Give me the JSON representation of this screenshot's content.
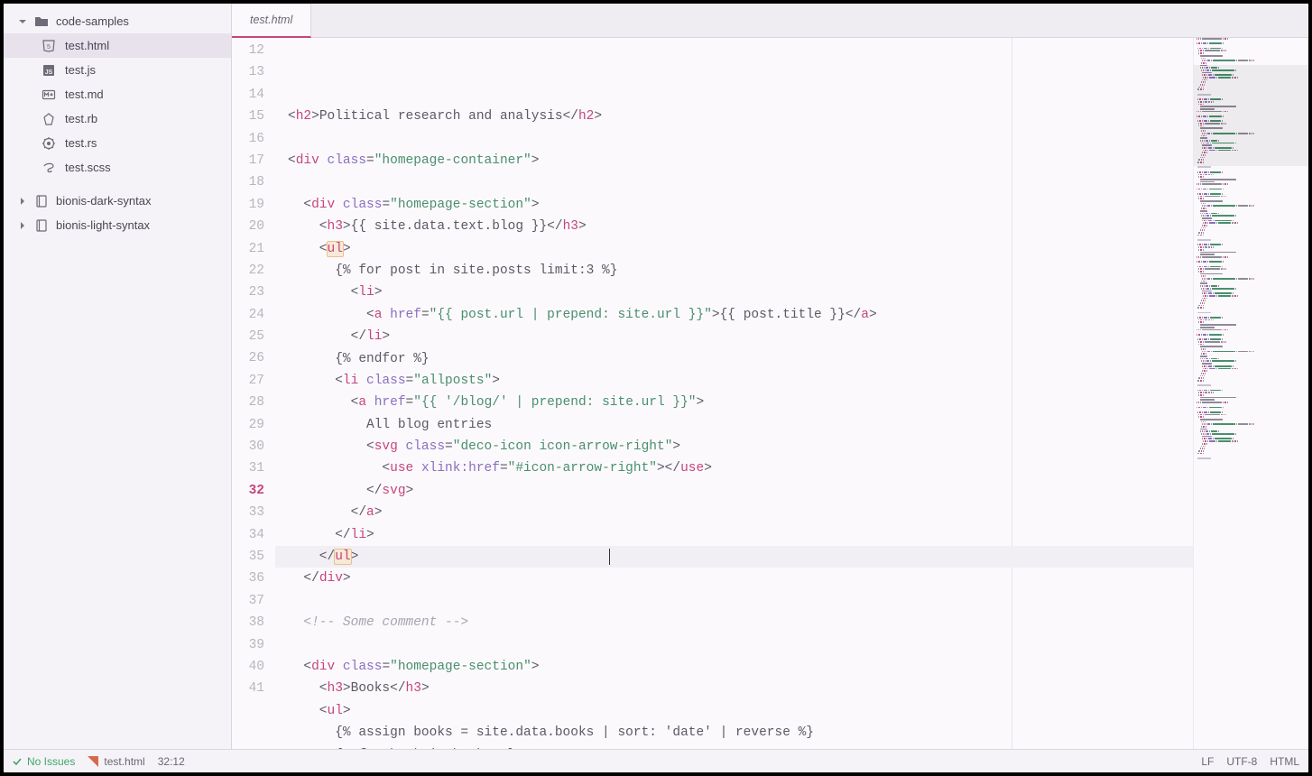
{
  "sidebar": {
    "root": {
      "name": "code-samples",
      "expanded": true
    },
    "files": [
      {
        "name": "test.html",
        "kind": "html",
        "active": true
      },
      {
        "name": "test.js",
        "kind": "js"
      },
      {
        "name": "test.md",
        "kind": "md"
      },
      {
        "name": "test.rb",
        "kind": "rb"
      },
      {
        "name": "test.rs",
        "kind": "rs"
      },
      {
        "name": "test.scss",
        "kind": "scss"
      }
    ],
    "folders": [
      {
        "name": "bionis-dark-syntax",
        "expanded": false
      },
      {
        "name": "bionis-light-syntax",
        "expanded": false
      }
    ]
  },
  "tab": {
    "title": "test.html"
  },
  "editor": {
    "first_line": 12,
    "cursor_line": 32,
    "lines": [
      [
        [
          "pn",
          "<"
        ],
        [
          "tg",
          "h2"
        ],
        [
          "pn",
          ">"
        ],
        [
          "tx",
          "Political research and analysis"
        ],
        [
          "pn",
          "</"
        ],
        [
          "tg",
          "h2"
        ],
        [
          "pn",
          ">"
        ]
      ],
      [],
      [
        [
          "pn",
          "<"
        ],
        [
          "tg",
          "div"
        ],
        [
          "pn",
          " "
        ],
        [
          "at",
          "class"
        ],
        [
          "pn",
          "="
        ],
        [
          "st",
          "\"homepage-container\""
        ],
        [
          "pn",
          ">"
        ]
      ],
      [],
      [
        [
          "pn",
          "  <"
        ],
        [
          "tg",
          "div"
        ],
        [
          "pn",
          " "
        ],
        [
          "at",
          "class"
        ],
        [
          "pn",
          "="
        ],
        [
          "st",
          "\"homepage-section\""
        ],
        [
          "pn",
          ">"
        ]
      ],
      [
        [
          "pn",
          "    <"
        ],
        [
          "tg",
          "h3"
        ],
        [
          "pn",
          ">"
        ],
        [
          "lq",
          "{{ site.data.text.blog }}"
        ],
        [
          "pn",
          "</"
        ],
        [
          "tg",
          "h3"
        ],
        [
          "pn",
          ">"
        ]
      ],
      [
        [
          "pn",
          "    <"
        ],
        [
          "hl",
          "ul"
        ],
        [
          "pn",
          ">"
        ]
      ],
      [
        [
          "lq",
          "      {% for post in site.posts limit:3 %}"
        ]
      ],
      [
        [
          "pn",
          "        <"
        ],
        [
          "tg",
          "li"
        ],
        [
          "pn",
          ">"
        ]
      ],
      [
        [
          "pn",
          "          <"
        ],
        [
          "tg",
          "a"
        ],
        [
          "pn",
          " "
        ],
        [
          "at",
          "href"
        ],
        [
          "pn",
          "="
        ],
        [
          "st",
          "\"{{ post.url | prepend: site.url }}\""
        ],
        [
          "pn",
          ">"
        ],
        [
          "lq",
          "{{ post.title }}"
        ],
        [
          "pn",
          "</"
        ],
        [
          "tg",
          "a"
        ],
        [
          "pn",
          ">"
        ]
      ],
      [
        [
          "pn",
          "        </"
        ],
        [
          "tg",
          "li"
        ],
        [
          "pn",
          ">"
        ]
      ],
      [
        [
          "lq",
          "      {% endfor %}"
        ]
      ],
      [
        [
          "pn",
          "      <"
        ],
        [
          "tg",
          "li"
        ],
        [
          "pn",
          " "
        ],
        [
          "at",
          "class"
        ],
        [
          "pn",
          "="
        ],
        [
          "st",
          "\"allposts\""
        ],
        [
          "pn",
          ">"
        ]
      ],
      [
        [
          "pn",
          "        <"
        ],
        [
          "tg",
          "a"
        ],
        [
          "pn",
          " "
        ],
        [
          "at",
          "href"
        ],
        [
          "pn",
          "="
        ],
        [
          "st",
          "\"{{ '/blog/' | prepend: site.url }}\""
        ],
        [
          "pn",
          ">"
        ]
      ],
      [
        [
          "tx",
          "          All blog entries"
        ]
      ],
      [
        [
          "pn",
          "          <"
        ],
        [
          "tg",
          "svg"
        ],
        [
          "pn",
          " "
        ],
        [
          "at",
          "class"
        ],
        [
          "pn",
          "="
        ],
        [
          "st",
          "\"deco-icon icon-arrow-right\""
        ],
        [
          "pn",
          ">"
        ]
      ],
      [
        [
          "pn",
          "            <"
        ],
        [
          "tg",
          "use"
        ],
        [
          "pn",
          " "
        ],
        [
          "at",
          "xlink:href"
        ],
        [
          "pn",
          "="
        ],
        [
          "st",
          "\"#icon-arrow-right\""
        ],
        [
          "pn",
          "></"
        ],
        [
          "tg",
          "use"
        ],
        [
          "pn",
          ">"
        ]
      ],
      [
        [
          "pn",
          "          </"
        ],
        [
          "tg",
          "svg"
        ],
        [
          "pn",
          ">"
        ]
      ],
      [
        [
          "pn",
          "        </"
        ],
        [
          "tg",
          "a"
        ],
        [
          "pn",
          ">"
        ]
      ],
      [
        [
          "pn",
          "      </"
        ],
        [
          "tg",
          "li"
        ],
        [
          "pn",
          ">"
        ]
      ],
      [
        [
          "pn",
          "    </"
        ],
        [
          "hl",
          "ul"
        ],
        [
          "pn",
          ">"
        ]
      ],
      [
        [
          "pn",
          "  </"
        ],
        [
          "tg",
          "div"
        ],
        [
          "pn",
          ">"
        ]
      ],
      [],
      [
        [
          "cm",
          "  <!-- Some comment -->"
        ]
      ],
      [],
      [
        [
          "pn",
          "  <"
        ],
        [
          "tg",
          "div"
        ],
        [
          "pn",
          " "
        ],
        [
          "at",
          "class"
        ],
        [
          "pn",
          "="
        ],
        [
          "st",
          "\"homepage-section\""
        ],
        [
          "pn",
          ">"
        ]
      ],
      [
        [
          "pn",
          "    <"
        ],
        [
          "tg",
          "h3"
        ],
        [
          "pn",
          ">"
        ],
        [
          "tx",
          "Books"
        ],
        [
          "pn",
          "</"
        ],
        [
          "tg",
          "h3"
        ],
        [
          "pn",
          ">"
        ]
      ],
      [
        [
          "pn",
          "    <"
        ],
        [
          "tg",
          "ul"
        ],
        [
          "pn",
          ">"
        ]
      ],
      [
        [
          "lq",
          "      {% assign books = site.data.books | sort: 'date' | reverse %}"
        ]
      ],
      [
        [
          "lq",
          "      {% for book in books %}"
        ]
      ]
    ]
  },
  "status": {
    "issues": "No Issues",
    "file": "test.html",
    "cursor": "32:12",
    "line_ending": "LF",
    "encoding": "UTF-8",
    "language": "HTML"
  }
}
